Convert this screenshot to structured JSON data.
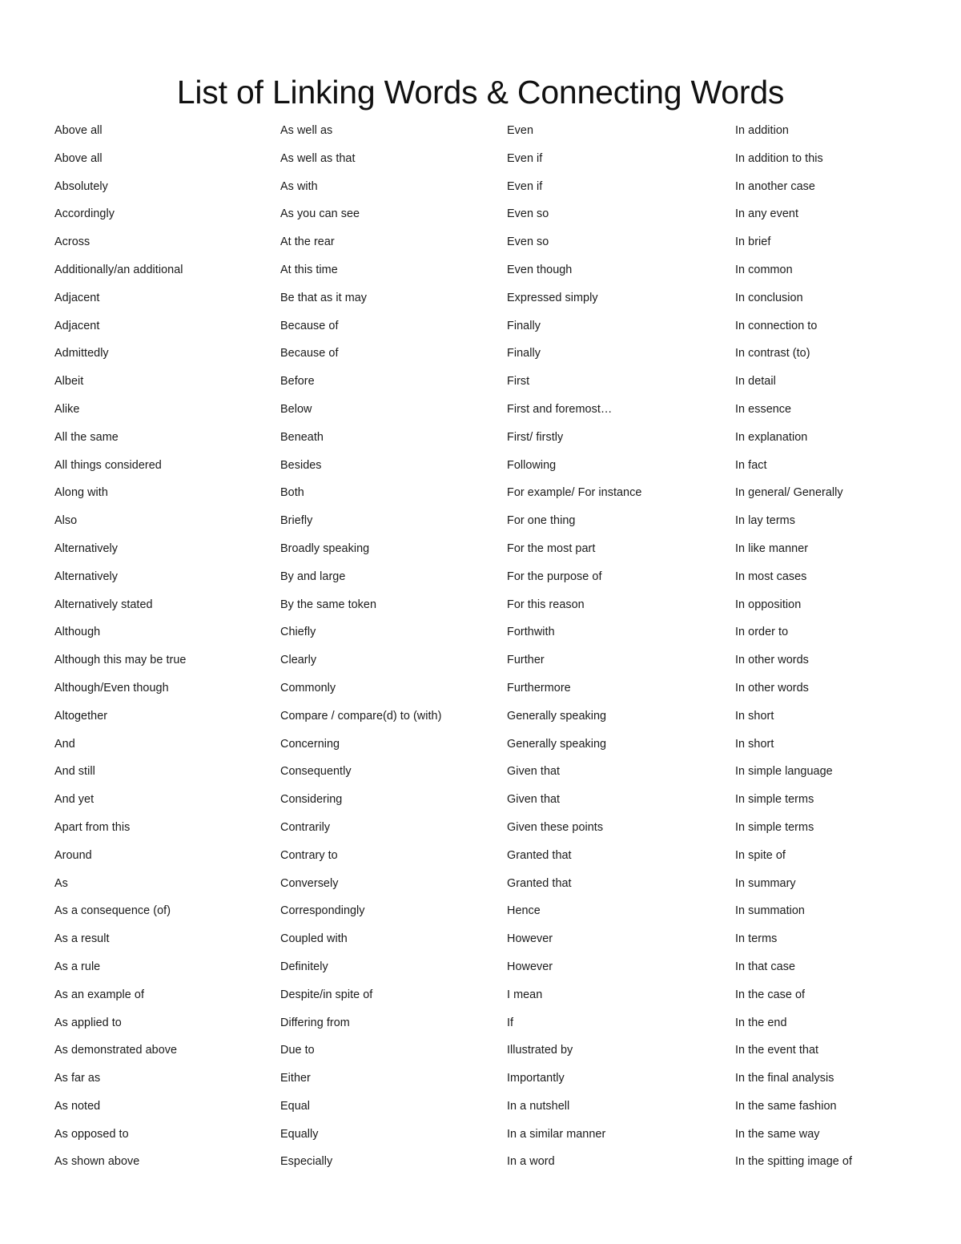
{
  "document": {
    "title": "List of Linking Words & Connecting Words"
  },
  "columns": [
    {
      "name": "column-1",
      "items": [
        "Above all",
        "Above all",
        "Absolutely",
        "Accordingly",
        "Across",
        "Additionally/an additional",
        "Adjacent",
        "Adjacent",
        "Admittedly",
        "Albeit",
        "Alike",
        "All the same",
        "All things considered",
        "Along with",
        "Also",
        "Alternatively",
        "Alternatively",
        "Alternatively stated",
        "Although",
        "Although this may be true",
        "Although/Even though",
        "Altogether",
        "And",
        "And still",
        "And yet",
        "Apart from this",
        "Around",
        "As",
        "As a consequence (of)",
        "As a result",
        "As a rule",
        "As an example of",
        "As applied to",
        "As demonstrated above",
        "As far as",
        "As noted",
        "As opposed to",
        "As shown above"
      ]
    },
    {
      "name": "column-2",
      "items": [
        "As well as",
        "As well as that",
        "As with",
        "As you can see",
        "At the rear",
        "At this time",
        "Be that as it may",
        "Because of",
        "Because of",
        "Before",
        "Below",
        "Beneath",
        "Besides",
        "Both",
        "Briefly",
        "Broadly speaking",
        "By and large",
        "By the same token",
        "Chiefly",
        "Clearly",
        "Commonly",
        "Compare / compare(d) to (with)",
        "Concerning",
        "Consequently",
        "Considering",
        "Contrarily",
        "Contrary to",
        "Conversely",
        "Correspondingly",
        "Coupled with",
        "Definitely",
        "Despite/in spite of",
        "Differing from",
        "Due to",
        "Either",
        "Equal",
        "Equally",
        "Especially"
      ]
    },
    {
      "name": "column-3",
      "items": [
        "Even",
        "Even if",
        "Even if",
        "Even so",
        "Even so",
        "Even though",
        "Expressed simply",
        "Finally",
        "Finally",
        "First",
        "First and foremost…",
        "First/ firstly",
        "Following",
        "For example/ For instance",
        "For one thing",
        "For the most part",
        "For the purpose of",
        "For this reason",
        "Forthwith",
        "Further",
        "Furthermore",
        "Generally speaking",
        "Generally speaking",
        "Given that",
        "Given that",
        "Given these points",
        "Granted that",
        "Granted that",
        "Hence",
        "However",
        "However",
        "I mean",
        "If",
        "Illustrated by",
        "Importantly",
        "In a nutshell",
        "In a similar manner",
        "In a word"
      ]
    },
    {
      "name": "column-4",
      "items": [
        "In addition",
        "In addition to this",
        "In another case",
        "In any event",
        "In brief",
        "In common",
        "In conclusion",
        "In connection to",
        "In contrast (to)",
        "In detail",
        "In essence",
        "In explanation",
        "In fact",
        "In general/ Generally",
        "In lay terms",
        "In like manner",
        "In most cases",
        "In opposition",
        "In order to",
        "In other words",
        "In other words",
        "In short",
        "In short",
        "In simple language",
        "In simple terms",
        "In simple terms",
        "In spite of",
        "In summary",
        "In summation",
        "In terms",
        "In that case",
        "In the case of",
        "In the end",
        "In the event that",
        "In the final analysis",
        "In the same fashion",
        "In the same way",
        "In the spitting image of"
      ]
    }
  ]
}
